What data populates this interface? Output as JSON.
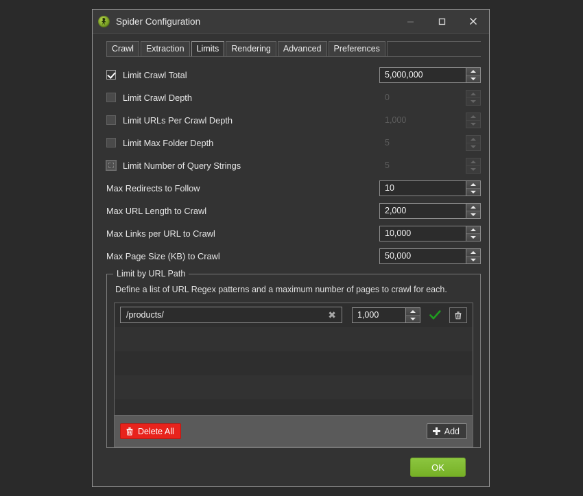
{
  "window": {
    "title": "Spider Configuration",
    "icon": "spider-app-icon",
    "controls": {
      "minimize": "minimize-icon",
      "maximize": "maximize-icon",
      "close": "close-icon"
    }
  },
  "tabs": [
    {
      "label": "Crawl",
      "active": false
    },
    {
      "label": "Extraction",
      "active": false
    },
    {
      "label": "Limits",
      "active": true
    },
    {
      "label": "Rendering",
      "active": false
    },
    {
      "label": "Advanced",
      "active": false
    },
    {
      "label": "Preferences",
      "active": false
    }
  ],
  "options": [
    {
      "label": "Limit Crawl Total",
      "has_checkbox": true,
      "checked": true,
      "focused": false,
      "value": "5,000,000",
      "enabled": true
    },
    {
      "label": "Limit Crawl Depth",
      "has_checkbox": true,
      "checked": false,
      "focused": false,
      "value": "0",
      "enabled": false
    },
    {
      "label": "Limit URLs Per Crawl Depth",
      "has_checkbox": true,
      "checked": false,
      "focused": false,
      "value": "1,000",
      "enabled": false
    },
    {
      "label": "Limit Max Folder Depth",
      "has_checkbox": true,
      "checked": false,
      "focused": false,
      "value": "5",
      "enabled": false
    },
    {
      "label": "Limit Number of Query Strings",
      "has_checkbox": true,
      "checked": false,
      "focused": true,
      "value": "5",
      "enabled": false
    },
    {
      "label": "Max Redirects to Follow",
      "has_checkbox": false,
      "checked": false,
      "focused": false,
      "value": "10",
      "enabled": true
    },
    {
      "label": "Max URL Length to Crawl",
      "has_checkbox": false,
      "checked": false,
      "focused": false,
      "value": "2,000",
      "enabled": true
    },
    {
      "label": "Max Links per URL to Crawl",
      "has_checkbox": false,
      "checked": false,
      "focused": false,
      "value": "10,000",
      "enabled": true
    },
    {
      "label": "Max Page Size (KB) to Crawl",
      "has_checkbox": false,
      "checked": false,
      "focused": false,
      "value": "50,000",
      "enabled": true
    }
  ],
  "url_path_group": {
    "title": "Limit by URL Path",
    "description": "Define a list of URL Regex patterns and a maximum number of pages to crawl for each.",
    "rows": [
      {
        "pattern": "/products/",
        "pattern_placeholder": "",
        "clear_icon": "clear-x-icon",
        "limit": "1,000",
        "status_icon": "valid-check-icon",
        "delete_icon": "trash-icon"
      }
    ],
    "empty_row_count": 4,
    "footer": {
      "delete_all_label": "Delete All",
      "delete_all_icon": "trash-icon",
      "add_label": "Add",
      "add_icon": "plus-icon"
    }
  },
  "footer": {
    "ok_label": "OK"
  },
  "colors": {
    "dialog_bg": "#333333",
    "titlebar_bg": "#3a3a3a",
    "accent_green": "#8cc63f",
    "danger_red": "#e8231c",
    "valid_check": "#1f9d1f",
    "text": "#e6e6e6"
  }
}
